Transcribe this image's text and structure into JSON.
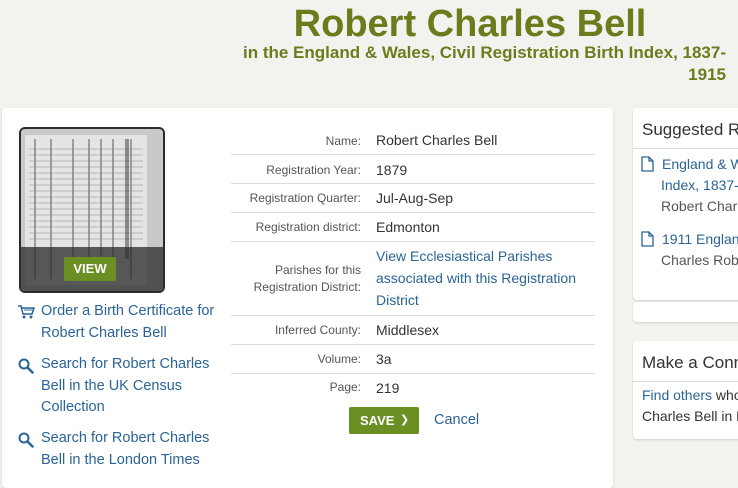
{
  "header": {
    "title": "Robert Charles Bell",
    "subtitle": "in the England & Wales, Civil Registration Birth Index, 1837-1915"
  },
  "image_viewer": {
    "view_label": "VIEW"
  },
  "side_links": [
    {
      "label": "Order a Birth Certificate for Robert Charles Bell",
      "icon": "cart-icon"
    },
    {
      "label": "Search for Robert Charles Bell in the UK Census Collection",
      "icon": "search-icon"
    },
    {
      "label": "Search for Robert Charles Bell in the London Times",
      "icon": "search-icon"
    }
  ],
  "record": [
    {
      "label": "Name:",
      "value": "Robert Charles Bell"
    },
    {
      "label": "Registration Year:",
      "value": "1879"
    },
    {
      "label": "Registration Quarter:",
      "value": "Jul-Aug-Sep"
    },
    {
      "label": "Registration district:",
      "value": "Edmonton"
    },
    {
      "label_line1": "Parishes for this",
      "label_line2": "Registration District:",
      "value": "View Ecclesiastical Parishes associated with this Registration District",
      "is_link": true
    },
    {
      "label": "Inferred County:",
      "value": "Middlesex"
    },
    {
      "label": "Volume:",
      "value": "3a"
    },
    {
      "label": "Page:",
      "value": "219"
    }
  ],
  "actions": {
    "save_label": "SAVE",
    "cancel_label": "Cancel"
  },
  "suggested": {
    "title": "Suggested R",
    "items": [
      {
        "line1": "England & W",
        "line2": "Index, 1837-",
        "line3": "Robert Charl"
      },
      {
        "line1": "1911 Englan",
        "line2": "Charles Robe"
      }
    ]
  },
  "connect": {
    "title": "Make a Conn",
    "link_text": "Find others",
    "rest_text": " who",
    "line2": "Charles Bell in F"
  },
  "colors": {
    "accent_green": "#6b7c1d",
    "button_green": "#6b8f23",
    "link_blue": "#2a6496"
  }
}
